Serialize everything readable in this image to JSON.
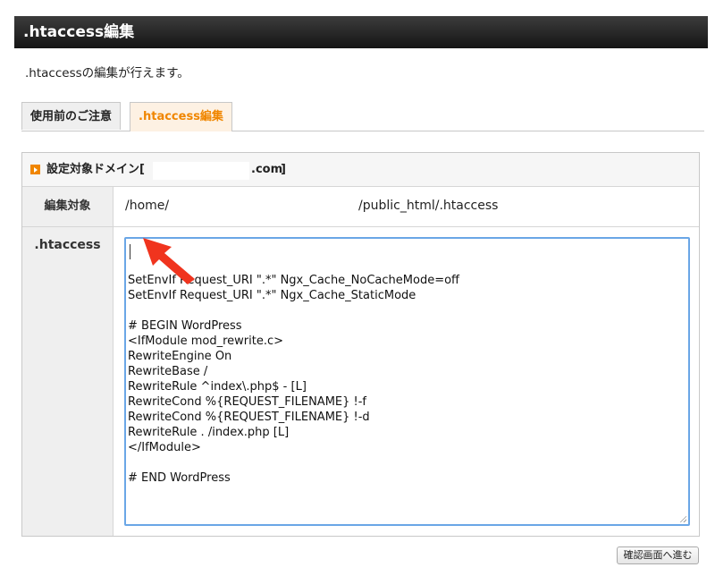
{
  "header": {
    "title": ".htaccess編集"
  },
  "description": ".htaccessの編集が行えます。",
  "tabs": [
    {
      "label": "使用前のご注意",
      "active": false
    },
    {
      "label": ".htaccess編集",
      "active": true
    }
  ],
  "panel": {
    "domain_label": "設定対象ドメイン[",
    "domain_suffix": ".com",
    "domain_close": "]",
    "target_label": "編集対象",
    "target_path_start": "/home/",
    "target_path_end": "/public_html/.htaccess",
    "editor_label": ".htaccess",
    "editor_content": "SetEnvIf Request_URI \".*\" Ngx_Cache_NoCacheMode=off\nSetEnvIf Request_URI \".*\" Ngx_Cache_StaticMode\n\n# BEGIN WordPress\n<IfModule mod_rewrite.c>\nRewriteEngine On\nRewriteBase /\nRewriteRule ^index\\.php$ - [L]\nRewriteCond %{REQUEST_FILENAME} !-f\nRewriteCond %{REQUEST_FILENAME} !-d\nRewriteRule . /index.php [L]\n</IfModule>\n\n# END WordPress"
  },
  "confirm_button": "確認画面へ進む",
  "colors": {
    "accent": "#f08600",
    "annotation_arrow": "#f0341e",
    "focus_border": "#6aa6e6"
  }
}
